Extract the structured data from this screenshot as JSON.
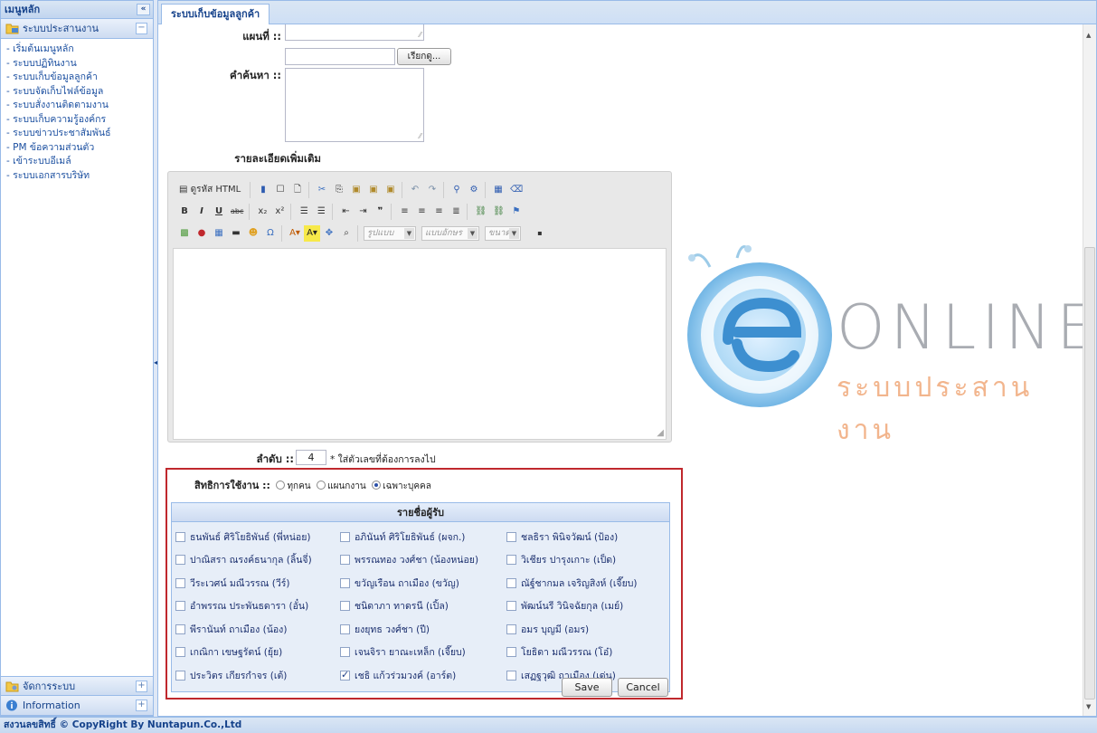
{
  "left_panel": {
    "title": "เมนูหลัก",
    "collapse_label": "«",
    "section_title": "ระบบประสานงาน",
    "menu_items": [
      "- เริ่มต้นเมนูหลัก",
      "- ระบบปฏิทินงาน",
      "- ระบบเก็บข้อมูลลูกค้า",
      "- ระบบจัดเก็บไฟล์ข้อมูล",
      "- ระบบสั่งงานติดตามงาน",
      "- ระบบเก็บความรู้องค์กร",
      "- ระบบข่าวประชาสัมพันธ์",
      "- PM ข้อความส่วนตัว",
      "- เข้าระบบอีเมล์",
      "- ระบบเอกสารบริษัท"
    ],
    "bottom_sections": [
      "จัดการระบบ",
      "Information"
    ]
  },
  "tab": {
    "label": "ระบบเก็บข้อมูลลูกค้า"
  },
  "form": {
    "department_label": "แผนที่ ::",
    "browse_button": "เรียกดู...",
    "keyword_label": "คำค้นหา ::",
    "details_label": "รายละเอียดเพิ่มเติม",
    "order_label": "ลำดับ ::",
    "order_value": "4",
    "order_hint": "* ใส่ตัวเลขที่ต้องการลงไป"
  },
  "editor": {
    "source_label": "ดูรหัส HTML",
    "style_combo": "รูปแบบ",
    "font_combo": "แบบอักษร",
    "size_combo": "ขนาด"
  },
  "permission": {
    "label": "สิทธิการใช้งาน ::",
    "options": [
      "ทุกคน",
      "แผนกงาน",
      "เฉพาะบุคคล"
    ],
    "selected": "เฉพาะบุคคล",
    "grid_title": "รายชื่อผู้รับ",
    "people": [
      [
        "ธนพันธ์ ศิริโยธิพันธ์ (พี่หน่อย)",
        "อภินันท์ ศิริโยธิพันธ์ (ผจก.)",
        "ชลธิรา พินิจวัฒน์ (ป้อง)"
      ],
      [
        "ปาณิสรา ณรงค์ธนากุล (ลิ้นจี่)",
        "พรรณทอง วงศ์ชา (น้องหน่อย)",
        "วิเชียร ปารุงเกาะ (เป็ด)"
      ],
      [
        "วีระเวศน์ มณีวรรณ (วีร์)",
        "ขวัญเรือน ถาเมือง (ขวัญ)",
        "ณัฐ์ชากมล เจริญสิงห์ (เจี๊ยบ)"
      ],
      [
        "อำพรรณ ประพันธดารา (อั๋น)",
        "ชนิดาภา ทาดรนี (เปิ้ล)",
        "พัฒน์นรี วินิจฉัยกุล (เมย์)"
      ],
      [
        "พีรานันท์ ถาเมือง (น้อง)",
        "ยงยุทธ วงศ์ชา (ปี)",
        "อมร บุญมี (อมร)"
      ],
      [
        "เกณิกา เขษฐรัตน์ (ยุ้ย)",
        "เจนจิรา ยาณะเหล็ก (เจี๊ยบ)",
        "โยธิดา มณีวรรณ (โอ๋)"
      ],
      [
        "ประวิตร เกียรกำจร (เต้)",
        "เชธิ แก้วร่วมวงค์ (อาร์ต)",
        "เสฏฐวุฒิ ถาเมือง (เด่น)"
      ]
    ],
    "checked": "เชธิ แก้วร่วมวงค์ (อาร์ต)"
  },
  "actions": {
    "save": "Save",
    "cancel": "Cancel"
  },
  "footer": {
    "text": "สงวนลขสิทธิ์ © CopyRight By Nuntapun.Co.,Ltd"
  },
  "logo": {
    "word": "ONLINE",
    "sub": "ระบบประสานงาน",
    "colors": {
      "word": "#a9acb2",
      "sub": "#f2b58d",
      "swirl": "#5aa9e0"
    }
  },
  "colors": {
    "panel_border": "#99bbe8",
    "header_text": "#15428b",
    "highlight_border": "#c0282d"
  }
}
